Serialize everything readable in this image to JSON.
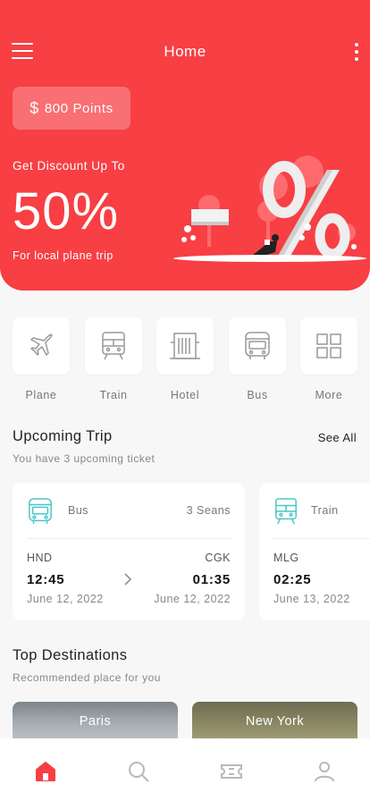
{
  "header": {
    "title": "Home",
    "points_label": "800 Points",
    "currency_symbol": "$",
    "discount_label": "Get Discount Up To",
    "discount_value": "50%",
    "discount_note": "For local plane trip"
  },
  "colors": {
    "primary": "#f73f44",
    "background": "#f7f7f8",
    "card": "#ffffff",
    "accent_teal": "#4bc6c8"
  },
  "categories": [
    {
      "label": "Plane",
      "icon": "plane-icon"
    },
    {
      "label": "Train",
      "icon": "train-icon"
    },
    {
      "label": "Hotel",
      "icon": "hotel-icon"
    },
    {
      "label": "Bus",
      "icon": "bus-icon"
    },
    {
      "label": "More",
      "icon": "grid-icon"
    }
  ],
  "upcoming": {
    "title": "Upcoming Trip",
    "subtitle": "You have 3 upcoming ticket",
    "see_all": "See All",
    "trips": [
      {
        "type": "Bus",
        "icon": "bus-icon",
        "seats": "3 Seans",
        "from_code": "HND",
        "from_time": "12:45",
        "from_date": "June 12, 2022",
        "to_code": "CGK",
        "to_time": "01:35",
        "to_date": "June 12, 2022"
      },
      {
        "type": "Train",
        "icon": "train-icon",
        "from_code": "MLG",
        "from_time": "02:25",
        "from_date": "June 13, 2022"
      }
    ]
  },
  "destinations": {
    "title": "Top Destinations",
    "subtitle": "Recommended place for you",
    "items": [
      {
        "name": "Paris"
      },
      {
        "name": "New York"
      }
    ]
  },
  "bottom_nav": [
    {
      "name": "home-icon",
      "active": true
    },
    {
      "name": "search-icon",
      "active": false
    },
    {
      "name": "ticket-icon",
      "active": false
    },
    {
      "name": "profile-icon",
      "active": false
    }
  ]
}
